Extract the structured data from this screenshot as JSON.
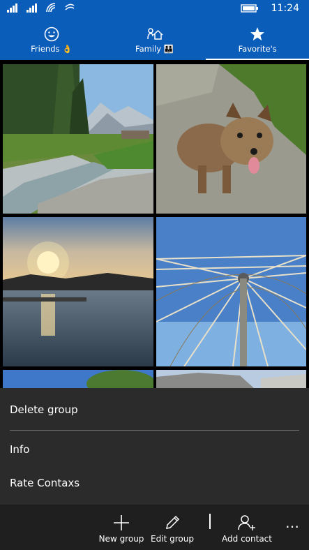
{
  "status": {
    "time": "11:24",
    "icons": [
      "signal-1-icon",
      "signal-2-icon",
      "wifi-icon",
      "data-icon",
      "battery-icon"
    ]
  },
  "tabs": [
    {
      "label": "Friends 👌",
      "icon": "smiley-icon"
    },
    {
      "label": "Family 👪",
      "icon": "home-people-icon"
    },
    {
      "label": "Favorite's",
      "icon": "star-icon",
      "active": true
    }
  ],
  "photos": [
    {
      "name": "mountain-river-photo"
    },
    {
      "name": "dog-photo"
    },
    {
      "name": "sunset-lake-photo"
    },
    {
      "name": "ferris-wheel-photo"
    },
    {
      "name": "tree-sky-photo"
    },
    {
      "name": "building-photo"
    }
  ],
  "menu": {
    "delete_group": "Delete group",
    "info": "Info",
    "rate": "Rate Contaxs"
  },
  "appbar": {
    "new_group": "New group",
    "edit_group": "Edit group",
    "add_contact": "Add contact",
    "more": "…"
  },
  "colors": {
    "accent": "#0a5db8",
    "menu_bg": "#2b2b2b",
    "appbar_bg": "#1f1f1f"
  }
}
